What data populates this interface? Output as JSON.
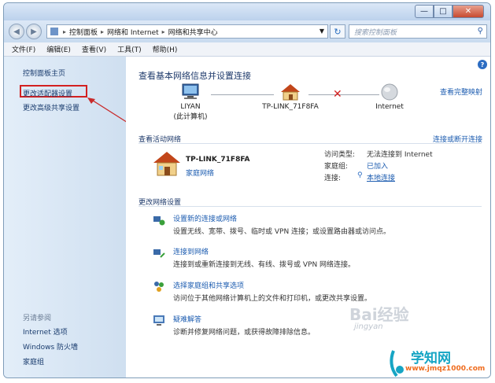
{
  "window": {
    "controls": {
      "minimize": "—",
      "maximize": "□",
      "close": "✕"
    }
  },
  "address": {
    "crumbs": [
      "控制面板",
      "网络和 Internet",
      "网络和共享中心"
    ],
    "search_placeholder": "搜索控制面板"
  },
  "menu": [
    "文件(F)",
    "编辑(E)",
    "查看(V)",
    "工具(T)",
    "帮助(H)"
  ],
  "sidebar": {
    "home": "控制面板主页",
    "adapter": "更改适配器设置",
    "advanced": "更改高级共享设置",
    "see_also": "另请参阅",
    "links": [
      "Internet 选项",
      "Windows 防火墙",
      "家庭组"
    ]
  },
  "main": {
    "heading": "查看基本网络信息并设置连接",
    "full_map": "查看完整映射",
    "nodes": {
      "computer": "LIYAN",
      "computer_sub": "(此计算机)",
      "router": "TP-LINK_71F8FA",
      "internet": "Internet"
    },
    "active_title": "查看活动网络",
    "connect_disconnect": "连接或断开连接",
    "network_name": "TP-LINK_71F8FA",
    "network_type": "家庭网络",
    "access_type_label": "访问类型:",
    "access_type_value": "无法连接到 Internet",
    "homegroup_label": "家庭组:",
    "homegroup_value": "已加入",
    "connection_label": "连接:",
    "connection_value": "本地连接",
    "change_title": "更改网络设置",
    "tasks": [
      {
        "link": "设置新的连接或网络",
        "desc": "设置无线、宽带、拨号、临时或 VPN 连接；或设置路由器或访问点。"
      },
      {
        "link": "连接到网络",
        "desc": "连接到或重新连接到无线、有线、拨号或 VPN 网络连接。"
      },
      {
        "link": "选择家庭组和共享选项",
        "desc": "访问位于其他网络计算机上的文件和打印机，或更改共享设置。"
      },
      {
        "link": "疑难解答",
        "desc": "诊断并修复网络问题，或获得故障排除信息。"
      }
    ]
  },
  "watermark": {
    "text": "Bai经验",
    "sub": "jingyan"
  },
  "site_logo": {
    "name": "学知网",
    "url": "www.jmqz1000.com"
  },
  "colors": {
    "link": "#1c5cb0",
    "highlight": "#d32020",
    "sidebar_bg": "#d9e6f4"
  }
}
